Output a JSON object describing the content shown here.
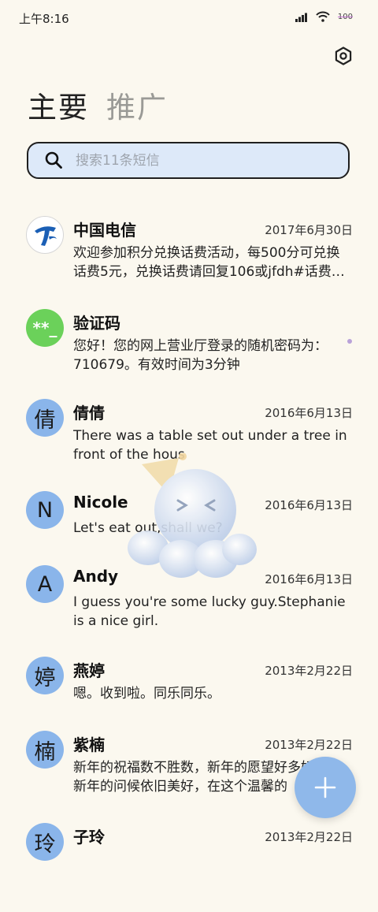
{
  "status": {
    "time": "上午8:16",
    "battery": "100"
  },
  "tabs": [
    {
      "label": "主要"
    },
    {
      "label": "推广"
    }
  ],
  "search": {
    "placeholder": "搜索11条短信"
  },
  "messages": [
    {
      "name": "中国电信",
      "date": "2017年6月30日",
      "snippet": "欢迎参加积分兑换话费活动，每500分可兑换话费5元，兑换话费请回复106或jfdh#话费…",
      "avatar": "telecom-logo"
    },
    {
      "name": "验证码",
      "date": "",
      "snippet": "您好！您的网上营业厅登录的随机密码为：710679。有效时间为3分钟",
      "avatar_text": "**_"
    },
    {
      "name": "倩倩",
      "date": "2016年6月13日",
      "snippet": "There was a table set out under a tree in front of the hous",
      "avatar_text": "倩"
    },
    {
      "name": "Nicole",
      "date": "2016年6月13日",
      "snippet": "Let's eat out,shall we?",
      "avatar_text": "N"
    },
    {
      "name": "Andy",
      "date": "2016年6月13日",
      "snippet": "I guess you're some lucky guy.Stephanie is a nice girl.",
      "avatar_text": "A"
    },
    {
      "name": "燕婷",
      "date": "2013年2月22日",
      "snippet": "嗯。收到啦。同乐同乐。",
      "avatar_text": "婷"
    },
    {
      "name": "紫楠",
      "date": "2013年2月22日",
      "snippet": "新年的祝福数不胜数，新年的愿望好多好多，新年的问候依旧美好，在这个温馨的",
      "avatar_text": "楠"
    },
    {
      "name": "子玲",
      "date": "2013年2月22日",
      "snippet": "",
      "avatar_text": "玲"
    }
  ],
  "colors": {
    "background": "#fbf8ef",
    "search_bg": "#dde9f9",
    "avatar_blue": "#8ab5ea",
    "avatar_green": "#6bd15a",
    "fab": "#8fb8ea",
    "telecom_blue": "#1b5fb5"
  },
  "icons": {
    "settings": "settings-icon",
    "search": "search-icon",
    "compose": "plus-icon",
    "signal": "signal-icon",
    "wifi": "wifi-icon"
  }
}
